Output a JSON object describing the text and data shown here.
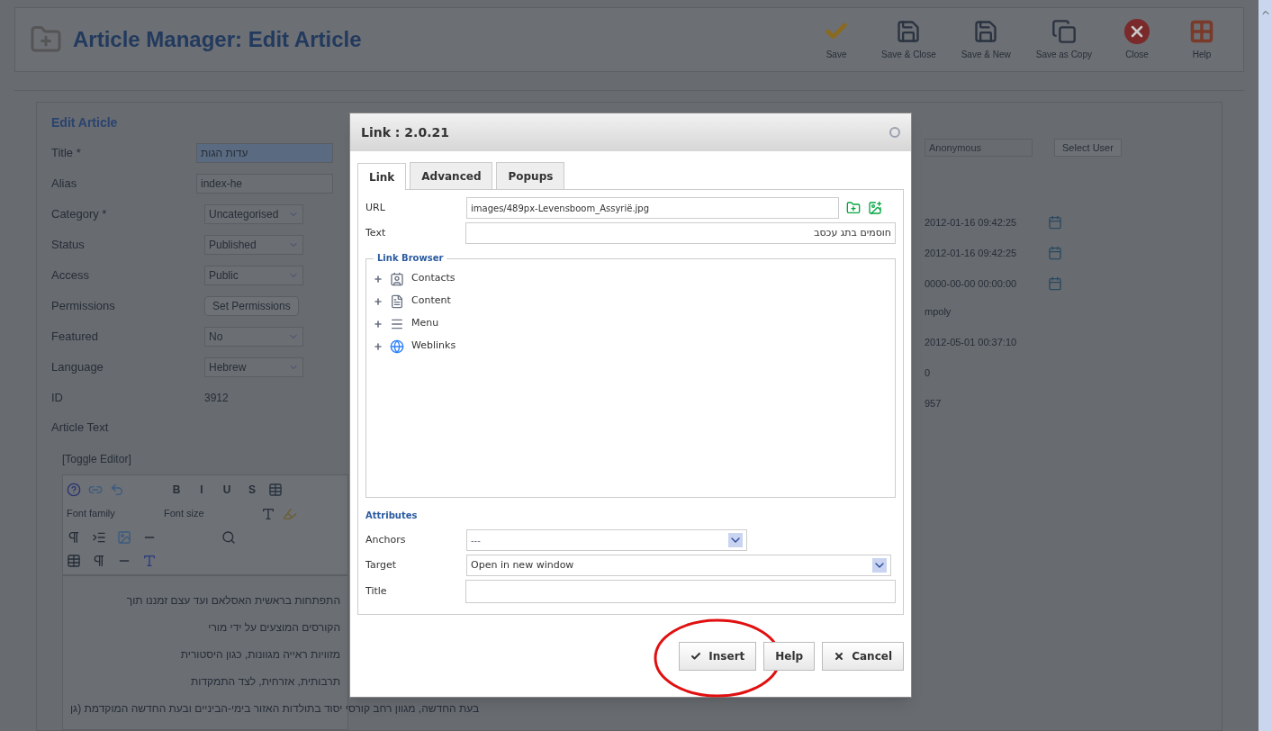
{
  "header": {
    "title": "Article Manager: Edit Article",
    "actions": [
      {
        "kind": "check",
        "label": "Save"
      },
      {
        "kind": "disk",
        "label": "Save & Close"
      },
      {
        "kind": "disk",
        "label": "Save & New"
      },
      {
        "kind": "copy",
        "label": "Save as Copy"
      },
      {
        "kind": "close",
        "label": "Close"
      },
      {
        "kind": "help",
        "label": "Help"
      }
    ]
  },
  "form": {
    "legend": "Edit Article",
    "rows": [
      {
        "label": "Title *",
        "kind": "input",
        "value": "עדות הגות",
        "selected": true
      },
      {
        "label": "Alias",
        "kind": "input",
        "value": "index-he",
        "selected": false
      },
      {
        "label": "Category *",
        "kind": "select",
        "value": "Uncategorised",
        "selected": false
      },
      {
        "label": "Status",
        "kind": "select",
        "value": "Published",
        "selected": false
      },
      {
        "label": "Access",
        "kind": "select",
        "value": "Public",
        "selected": false
      },
      {
        "label": "Permissions",
        "kind": "button",
        "value": "Set Permissions",
        "selected": false
      },
      {
        "label": "Featured",
        "kind": "select",
        "value": "No",
        "selected": false
      },
      {
        "label": "Language",
        "kind": "select",
        "value": "Hebrew",
        "selected": false
      },
      {
        "label": "ID",
        "kind": "text",
        "value": "3912",
        "selected": false
      }
    ],
    "article_text_label": "Article Text",
    "toggle": "[Toggle Editor]",
    "format_buttons": [
      "B",
      "I",
      "U",
      "S"
    ],
    "font_family": "Font family",
    "font_size": "Font size",
    "body_lines": [
      "התפתחות בראשית האסלאם ועד עצם זמננו תוך",
      "הקורסים המוצעים על ידי מורי",
      "מזוויות ראייה מגוונות, כגון היסטורית",
      "תרבותית, אזרחית, לצד התמקדות"
    ],
    "last_line": "בעת החדשה, מגוון רחב קורסי יסוד בתולדות האזור בימי-הביניים ובעת החדשה המוקדמת (גן"
  },
  "side": {
    "user_placeholder": "Anonymous",
    "select_user": "Select User",
    "fields": [
      {
        "kind": "date",
        "value": "2012-01-16 09:42:25"
      },
      {
        "kind": "date",
        "value": "2012-01-16 09:42:25"
      },
      {
        "kind": "date",
        "value": "0000-00-00 00:00:00"
      },
      {
        "kind": "text",
        "value": "mpoly"
      },
      {
        "kind": "text",
        "value": "2012-05-01 00:37:10"
      },
      {
        "kind": "text",
        "value": "0"
      },
      {
        "kind": "text",
        "value": "957"
      }
    ]
  },
  "dialog": {
    "title": "Link : 2.0.21",
    "tabs": [
      {
        "label": "Link",
        "selected": true
      },
      {
        "label": "Advanced",
        "selected": false
      },
      {
        "label": "Popups",
        "selected": false
      }
    ],
    "url_label": "URL",
    "url": "images/489px-Levensboom_Assyrië.jpg",
    "text_label": "Text",
    "text": "חוסמים בתג עכסב",
    "browser_legend": "Link Browser",
    "tree": [
      {
        "kind": "contacts",
        "label": "Contacts"
      },
      {
        "kind": "content",
        "label": "Content"
      },
      {
        "kind": "menu",
        "label": "Menu"
      },
      {
        "kind": "weblinks",
        "label": "Weblinks"
      }
    ],
    "attributes_legend": "Attributes",
    "anchors_label": "Anchors",
    "anchors": "---",
    "target_label": "Target",
    "target": "Open in new window",
    "title_label": "Title",
    "buttons": [
      {
        "kind": "insert",
        "label": "Insert",
        "highlighted": true
      },
      {
        "kind": "help",
        "label": "Help",
        "highlighted": false
      },
      {
        "kind": "cancel",
        "label": "Cancel",
        "highlighted": false
      }
    ]
  }
}
